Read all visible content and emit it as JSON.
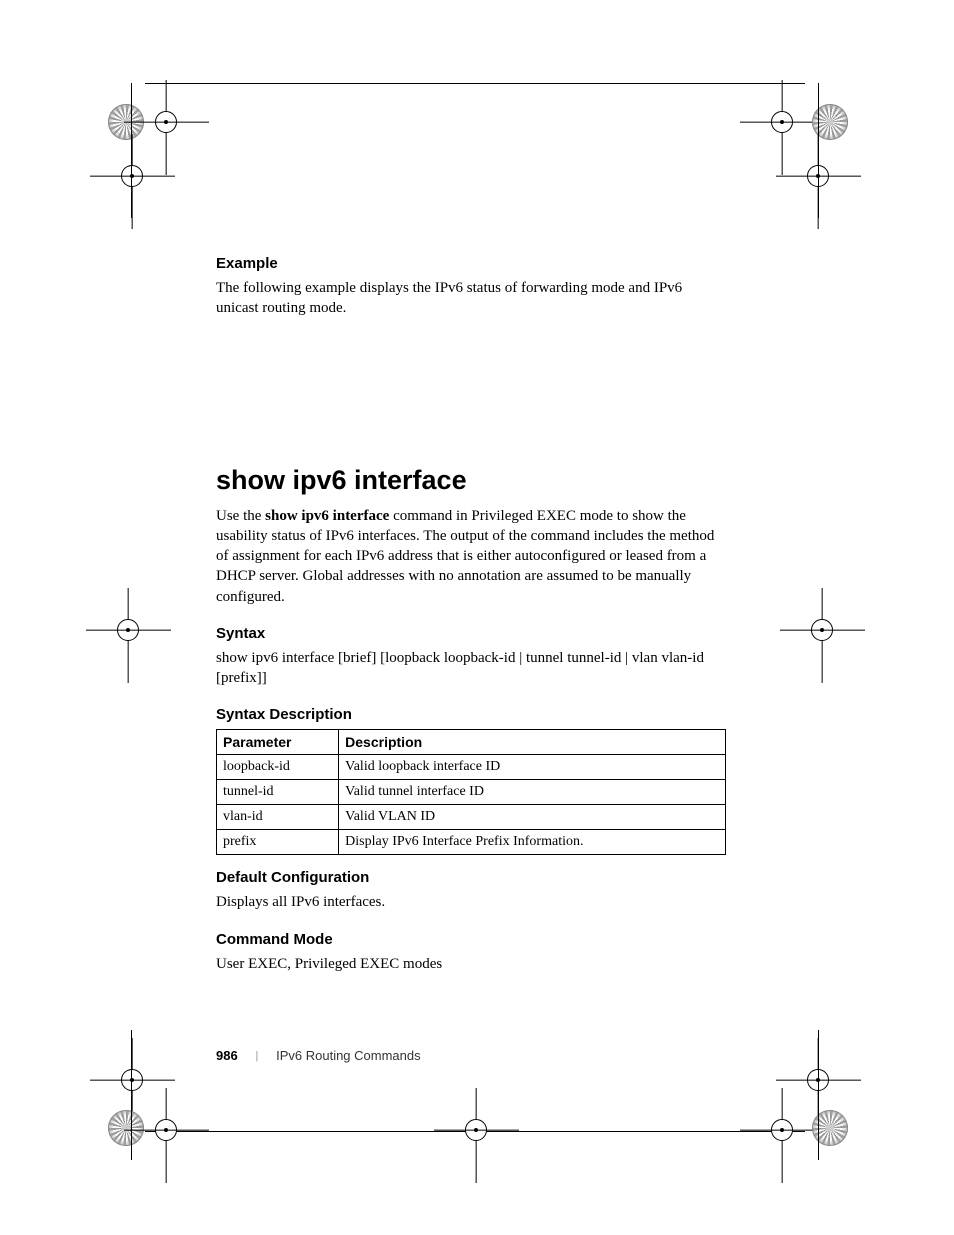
{
  "example": {
    "heading": "Example",
    "body": "The following example displays the IPv6 status of forwarding mode and IPv6 unicast routing mode."
  },
  "command": {
    "title": "show ipv6 interface",
    "intro_prefix": "Use the ",
    "intro_bold": "show ipv6 interface",
    "intro_suffix": " command in Privileged EXEC mode to show the usability status of IPv6 interfaces. The output of the command includes the method of assignment for each IPv6 address that is either autoconfigured or leased from a DHCP server. Global addresses with no annotation are assumed to be manually configured."
  },
  "syntax": {
    "heading": "Syntax",
    "body": "show ipv6 interface [brief] [loopback loopback-id | tunnel tunnel-id | vlan vlan-id [prefix]]"
  },
  "syntax_description": {
    "heading": "Syntax Description",
    "col_parameter": "Parameter",
    "col_description": "Description",
    "rows": [
      {
        "param": "loopback-id",
        "desc": "Valid loopback interface ID"
      },
      {
        "param": "tunnel-id",
        "desc": "Valid tunnel interface ID"
      },
      {
        "param": "vlan-id",
        "desc": "Valid VLAN ID"
      },
      {
        "param": "prefix",
        "desc": "Display IPv6 Interface Prefix Information."
      }
    ]
  },
  "default_config": {
    "heading": "Default Configuration",
    "body": "Displays all IPv6 interfaces."
  },
  "command_mode": {
    "heading": "Command Mode",
    "body": "User EXEC, Privileged EXEC modes"
  },
  "footer": {
    "page": "986",
    "divider": "|",
    "section": "IPv6 Routing Commands"
  }
}
